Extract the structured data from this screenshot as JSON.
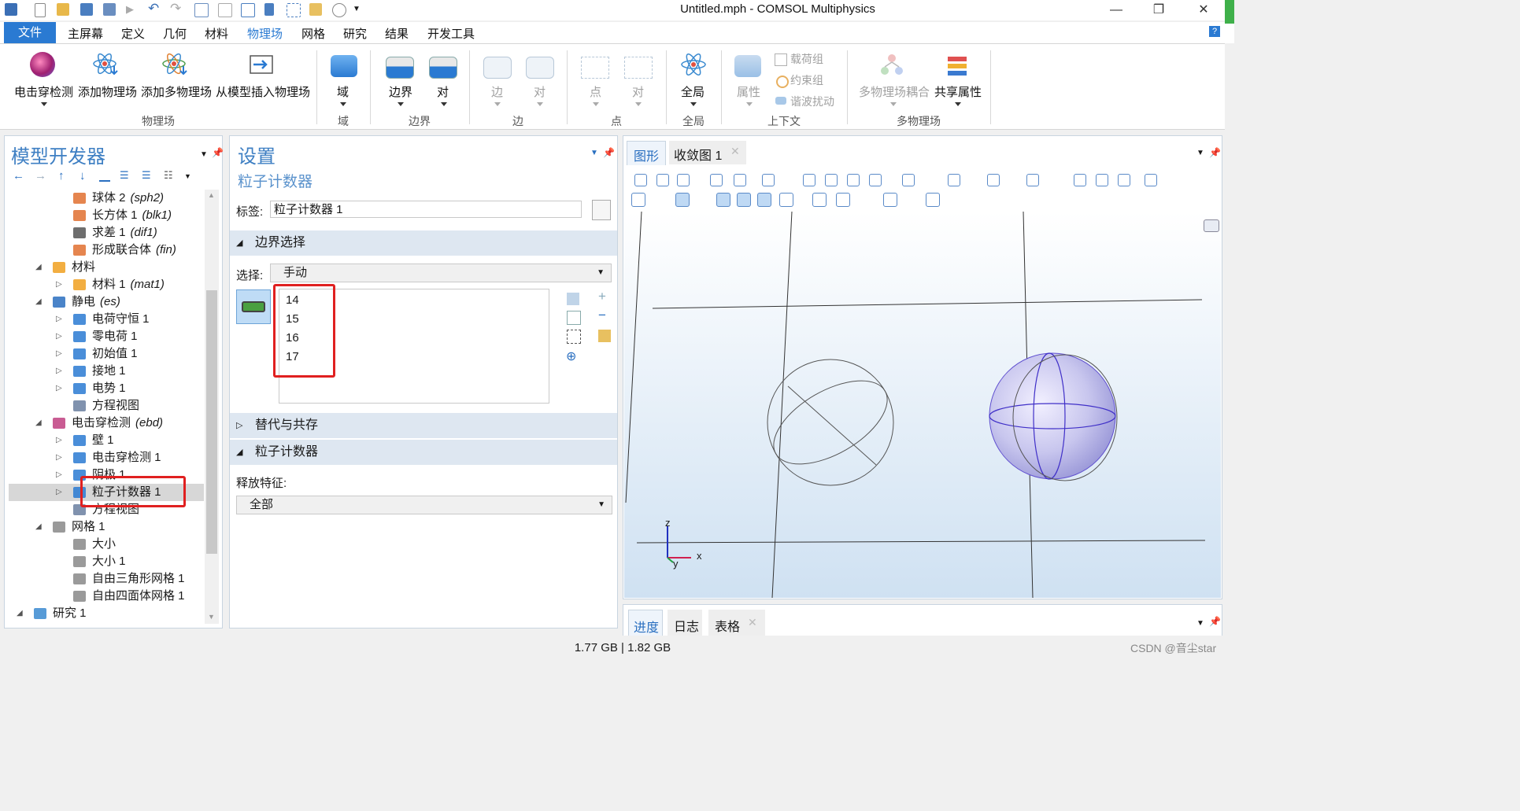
{
  "window": {
    "title": "Untitled.mph - COMSOL Multiphysics",
    "minimize_glyph": "—",
    "restore_glyph": "❐",
    "close_glyph": "✕"
  },
  "menu": {
    "file": "文件",
    "items": [
      "主屏幕",
      "定义",
      "几何",
      "材料",
      "物理场",
      "网格",
      "研究",
      "结果",
      "开发工具"
    ],
    "active": "物理场",
    "help": "?"
  },
  "ribbon": {
    "physics_group": {
      "label": "物理场",
      "buttons": [
        "电击穿检测",
        "添加物理场",
        "添加多物理场",
        "从模型插入物理场"
      ]
    },
    "domain_group": {
      "label": "域",
      "buttons": [
        "域"
      ]
    },
    "boundary_group": {
      "label": "边界",
      "buttons": [
        "边界",
        "对"
      ]
    },
    "edge_group": {
      "label": "边",
      "buttons": [
        "边",
        "对"
      ]
    },
    "point_group": {
      "label": "点",
      "buttons": [
        "点",
        "对"
      ]
    },
    "global_group": {
      "label": "全局",
      "buttons": [
        "全局"
      ]
    },
    "context_group": {
      "label": "上下文",
      "big": "属性",
      "small": [
        "载荷组",
        "约束组",
        "谐波扰动"
      ]
    },
    "multiphysics_group": {
      "label": "多物理场",
      "buttons": [
        "多物理场耦合",
        "共享属性"
      ]
    }
  },
  "model_builder": {
    "title": "模型开发器",
    "rows": [
      {
        "label": "球体 2",
        "tag": "(sph2)",
        "indent": 3,
        "icon": "sphere-icon",
        "color": "#e07030"
      },
      {
        "label": "长方体 1",
        "tag": "(blk1)",
        "indent": 3,
        "icon": "block-icon",
        "color": "#e07030"
      },
      {
        "label": "求差 1",
        "tag": "(dif1)",
        "indent": 3,
        "icon": "difference-icon",
        "color": "#555"
      },
      {
        "label": "形成联合体",
        "tag": "(fin)",
        "indent": 3,
        "icon": "form-union-icon",
        "color": "#e07030"
      },
      {
        "label": "材料",
        "tag": "",
        "indent": 2,
        "expanded": true,
        "icon": "materials-icon",
        "color": "#f0a020"
      },
      {
        "label": "材料 1",
        "tag": "(mat1)",
        "indent": 3,
        "collapsed": true,
        "icon": "material-icon",
        "color": "#f0a020"
      },
      {
        "label": "静电",
        "tag": "(es)",
        "indent": 2,
        "expanded": true,
        "icon": "electrostatics-icon",
        "color": "#2a6fc0"
      },
      {
        "label": "电荷守恒 1",
        "tag": "",
        "indent": 3,
        "collapsed": true,
        "icon": "domain-node-icon",
        "color": "#2a7ad2"
      },
      {
        "label": "零电荷 1",
        "tag": "",
        "indent": 3,
        "collapsed": true,
        "icon": "boundary-node-icon",
        "color": "#2a7ad2"
      },
      {
        "label": "初始值 1",
        "tag": "",
        "indent": 3,
        "collapsed": true,
        "icon": "domain-node-icon",
        "color": "#2a7ad2"
      },
      {
        "label": "接地 1",
        "tag": "",
        "indent": 3,
        "collapsed": true,
        "icon": "boundary-node-icon",
        "color": "#2a7ad2"
      },
      {
        "label": "电势 1",
        "tag": "",
        "indent": 3,
        "collapsed": true,
        "icon": "boundary-node-icon",
        "color": "#2a7ad2"
      },
      {
        "label": "方程视图",
        "tag": "",
        "indent": 3,
        "icon": "equation-view-icon",
        "color": "#6a7fa0"
      },
      {
        "label": "电击穿检测",
        "tag": "(ebd)",
        "indent": 2,
        "expanded": true,
        "icon": "breakdown-icon",
        "color": "#c04080"
      },
      {
        "label": "壁 1",
        "tag": "",
        "indent": 3,
        "collapsed": true,
        "icon": "boundary-node-icon",
        "color": "#2a7ad2"
      },
      {
        "label": "电击穿检测 1",
        "tag": "",
        "indent": 3,
        "collapsed": true,
        "icon": "domain-node-icon",
        "color": "#2a7ad2"
      },
      {
        "label": "阴极 1",
        "tag": "",
        "indent": 3,
        "collapsed": true,
        "icon": "boundary-node-icon",
        "color": "#2a7ad2"
      },
      {
        "label": "粒子计数器 1",
        "tag": "",
        "indent": 3,
        "collapsed": true,
        "selected": true,
        "icon": "boundary-node-icon",
        "color": "#2a7ad2"
      },
      {
        "label": "方程视图",
        "tag": "",
        "indent": 3,
        "icon": "equation-view-icon",
        "color": "#6a7fa0"
      },
      {
        "label": "网格 1",
        "tag": "",
        "indent": 2,
        "expanded": true,
        "icon": "mesh-icon",
        "color": "#888"
      },
      {
        "label": "大小",
        "tag": "",
        "indent": 3,
        "icon": "size-icon",
        "color": "#888"
      },
      {
        "label": "大小 1",
        "tag": "",
        "indent": 3,
        "icon": "size-icon",
        "color": "#888"
      },
      {
        "label": "自由三角形网格 1",
        "tag": "",
        "indent": 3,
        "icon": "free-triangular-icon",
        "color": "#888"
      },
      {
        "label": "自由四面体网格 1",
        "tag": "",
        "indent": 3,
        "icon": "free-tetrahedral-icon",
        "color": "#888"
      },
      {
        "label": "研究 1",
        "tag": "",
        "indent": 1,
        "expanded": true,
        "icon": "study-icon",
        "color": "#3a8ad0"
      }
    ]
  },
  "settings": {
    "title": "设置",
    "subtitle": "粒子计数器",
    "label_caption": "标签:",
    "label_value": "粒子计数器 1",
    "boundary_section": "边界选择",
    "selection_caption": "选择:",
    "selection_value": "手动",
    "boundaries": [
      "14",
      "15",
      "16",
      "17"
    ],
    "override_section": "替代与共存",
    "counter_section": "粒子计数器",
    "release_caption": "释放特征:",
    "release_value": "全部"
  },
  "graphics": {
    "tabs": [
      {
        "label": "图形",
        "active": true,
        "closable": false
      },
      {
        "label": "收敛图 1",
        "active": false,
        "closable": true
      }
    ],
    "axis_labels": {
      "z": "z",
      "x": "x",
      "y": "y"
    }
  },
  "bottom_tabs": [
    {
      "label": "进度",
      "active": true,
      "closable": false
    },
    {
      "label": "日志",
      "active": false,
      "closable": false
    },
    {
      "label": "表格",
      "active": false,
      "closable": true
    }
  ],
  "status": {
    "memory": "1.77 GB | 1.82 GB",
    "watermark": "CSDN @音尘star"
  },
  "colors": {
    "accent": "#2a7ad2",
    "panel_title": "#3e7fc3",
    "section_bg": "#dee7f1",
    "highlight_red": "#e02020",
    "viewport_top": "#ffffff",
    "viewport_bottom": "#cfe1f2"
  }
}
